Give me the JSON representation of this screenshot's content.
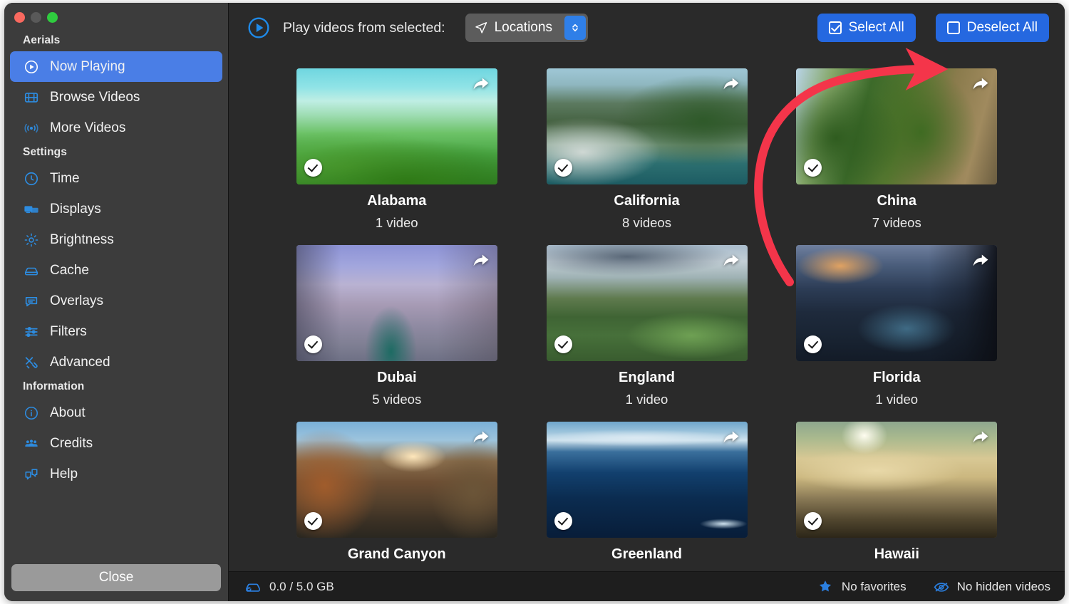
{
  "window": {
    "traffic_lights": [
      "close",
      "minimize",
      "maximize"
    ]
  },
  "sidebar": {
    "groups": [
      {
        "title": "Aerials",
        "items": [
          {
            "label": "Now Playing",
            "icon": "play-circle-icon",
            "active": true
          },
          {
            "label": "Browse Videos",
            "icon": "film-icon",
            "active": false
          },
          {
            "label": "More Videos",
            "icon": "broadcast-icon",
            "active": false
          }
        ]
      },
      {
        "title": "Settings",
        "items": [
          {
            "label": "Time",
            "icon": "clock-icon",
            "active": false
          },
          {
            "label": "Displays",
            "icon": "displays-icon",
            "active": false
          },
          {
            "label": "Brightness",
            "icon": "sun-icon",
            "active": false
          },
          {
            "label": "Cache",
            "icon": "drive-icon",
            "active": false
          },
          {
            "label": "Overlays",
            "icon": "bubble-icon",
            "active": false
          },
          {
            "label": "Filters",
            "icon": "sliders-icon",
            "active": false
          },
          {
            "label": "Advanced",
            "icon": "tools-icon",
            "active": false
          }
        ]
      },
      {
        "title": "Information",
        "items": [
          {
            "label": "About",
            "icon": "info-icon",
            "active": false
          },
          {
            "label": "Credits",
            "icon": "people-icon",
            "active": false
          },
          {
            "label": "Help",
            "icon": "help-icon",
            "active": false
          }
        ]
      }
    ],
    "close_label": "Close"
  },
  "toolbar": {
    "play_icon": "play-circle-icon",
    "label": "Play videos from selected:",
    "popup": {
      "icon": "location-arrow-icon",
      "value": "Locations",
      "stepper_icon": "up-down-chevron-icon"
    },
    "select_all_label": "Select All",
    "deselect_all_label": "Deselect All",
    "select_all_icon": "checked-box-icon",
    "deselect_all_icon": "empty-box-icon"
  },
  "grid": {
    "cards": [
      {
        "title": "Alabama",
        "count": "1 video",
        "checked": true,
        "share_icon": "share-arrow-icon"
      },
      {
        "title": "California",
        "count": "8 videos",
        "checked": true,
        "share_icon": "share-arrow-icon"
      },
      {
        "title": "China",
        "count": "7 videos",
        "checked": true,
        "share_icon": "share-arrow-icon"
      },
      {
        "title": "Dubai",
        "count": "5 videos",
        "checked": true,
        "share_icon": "share-arrow-icon"
      },
      {
        "title": "England",
        "count": "1 video",
        "checked": true,
        "share_icon": "share-arrow-icon"
      },
      {
        "title": "Florida",
        "count": "1 video",
        "checked": true,
        "share_icon": "share-arrow-icon"
      },
      {
        "title": "Grand Canyon",
        "count": "",
        "checked": true,
        "share_icon": "share-arrow-icon"
      },
      {
        "title": "Greenland",
        "count": "",
        "checked": true,
        "share_icon": "share-arrow-icon"
      },
      {
        "title": "Hawaii",
        "count": "",
        "checked": true,
        "share_icon": "share-arrow-icon"
      }
    ]
  },
  "statusbar": {
    "cache_icon": "drive-check-icon",
    "cache_text": "0.0 / 5.0 GB",
    "favorites_icon": "star-icon",
    "favorites_text": "No favorites",
    "hidden_icon": "eye-slash-icon",
    "hidden_text": "No hidden videos"
  },
  "annotation": {
    "type": "curved-arrow",
    "color": "#f23b४0",
    "points_to": "Deselect All"
  },
  "colors": {
    "accent_blue": "#2568e0",
    "sidebar_highlight": "#4a7ee6",
    "icon_blue": "#2d8ce0",
    "annotation_red": "#f4354a",
    "sidebar_bg": "#3c3c3c",
    "content_bg": "#2a2a2a",
    "statusbar_bg": "#1e1e1e"
  }
}
